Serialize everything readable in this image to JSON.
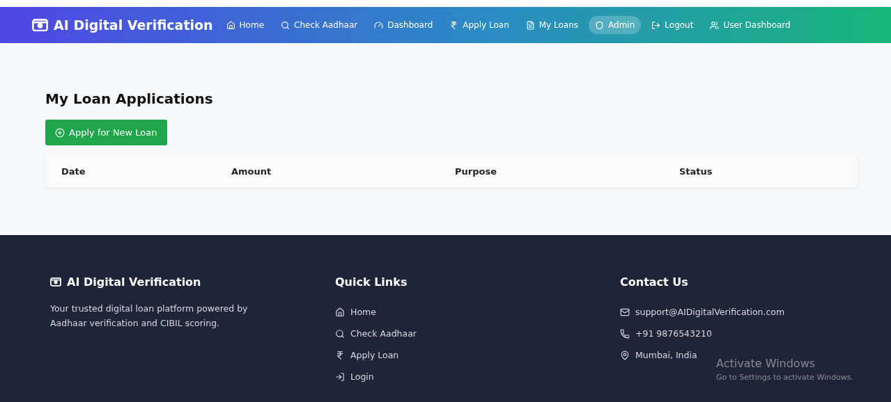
{
  "navbar": {
    "brand": "AI Digital Verification",
    "items": [
      {
        "kind": "home",
        "label": "Home",
        "selected": false
      },
      {
        "kind": "search",
        "label": "Check Aadhaar",
        "selected": false
      },
      {
        "kind": "gauge",
        "label": "Dashboard",
        "selected": false
      },
      {
        "kind": "rupee",
        "label": "Apply Loan",
        "selected": false
      },
      {
        "kind": "file",
        "label": "My Loans",
        "selected": false
      },
      {
        "kind": "shield",
        "label": "Admin",
        "selected": true
      },
      {
        "kind": "logout",
        "label": "Logout",
        "selected": false
      },
      {
        "kind": "users",
        "label": "User Dashboard",
        "selected": false
      }
    ]
  },
  "main": {
    "title": "My Loan Applications",
    "apply_button": "Apply for New Loan",
    "table": {
      "columns": [
        "Date",
        "Amount",
        "Purpose",
        "Status"
      ]
    }
  },
  "footer": {
    "brand": {
      "title": "AI Digital Verification",
      "description": "Your trusted digital loan platform powered by Aadhaar verification and CIBIL scoring."
    },
    "quick_links": {
      "title": "Quick Links",
      "items": [
        {
          "kind": "home",
          "label": "Home"
        },
        {
          "kind": "search",
          "label": "Check Aadhaar"
        },
        {
          "kind": "rupee",
          "label": "Apply Loan"
        },
        {
          "kind": "login",
          "label": "Login"
        }
      ]
    },
    "contact": {
      "title": "Contact Us",
      "items": [
        {
          "kind": "mail",
          "label": "support@AIDigitalVerification.com"
        },
        {
          "kind": "phone",
          "label": "+91 9876543210"
        },
        {
          "kind": "pin",
          "label": "Mumbai, India"
        }
      ]
    }
  },
  "os_notice": {
    "title": "Activate Windows",
    "subtitle": "Go to Settings to activate Windows."
  }
}
